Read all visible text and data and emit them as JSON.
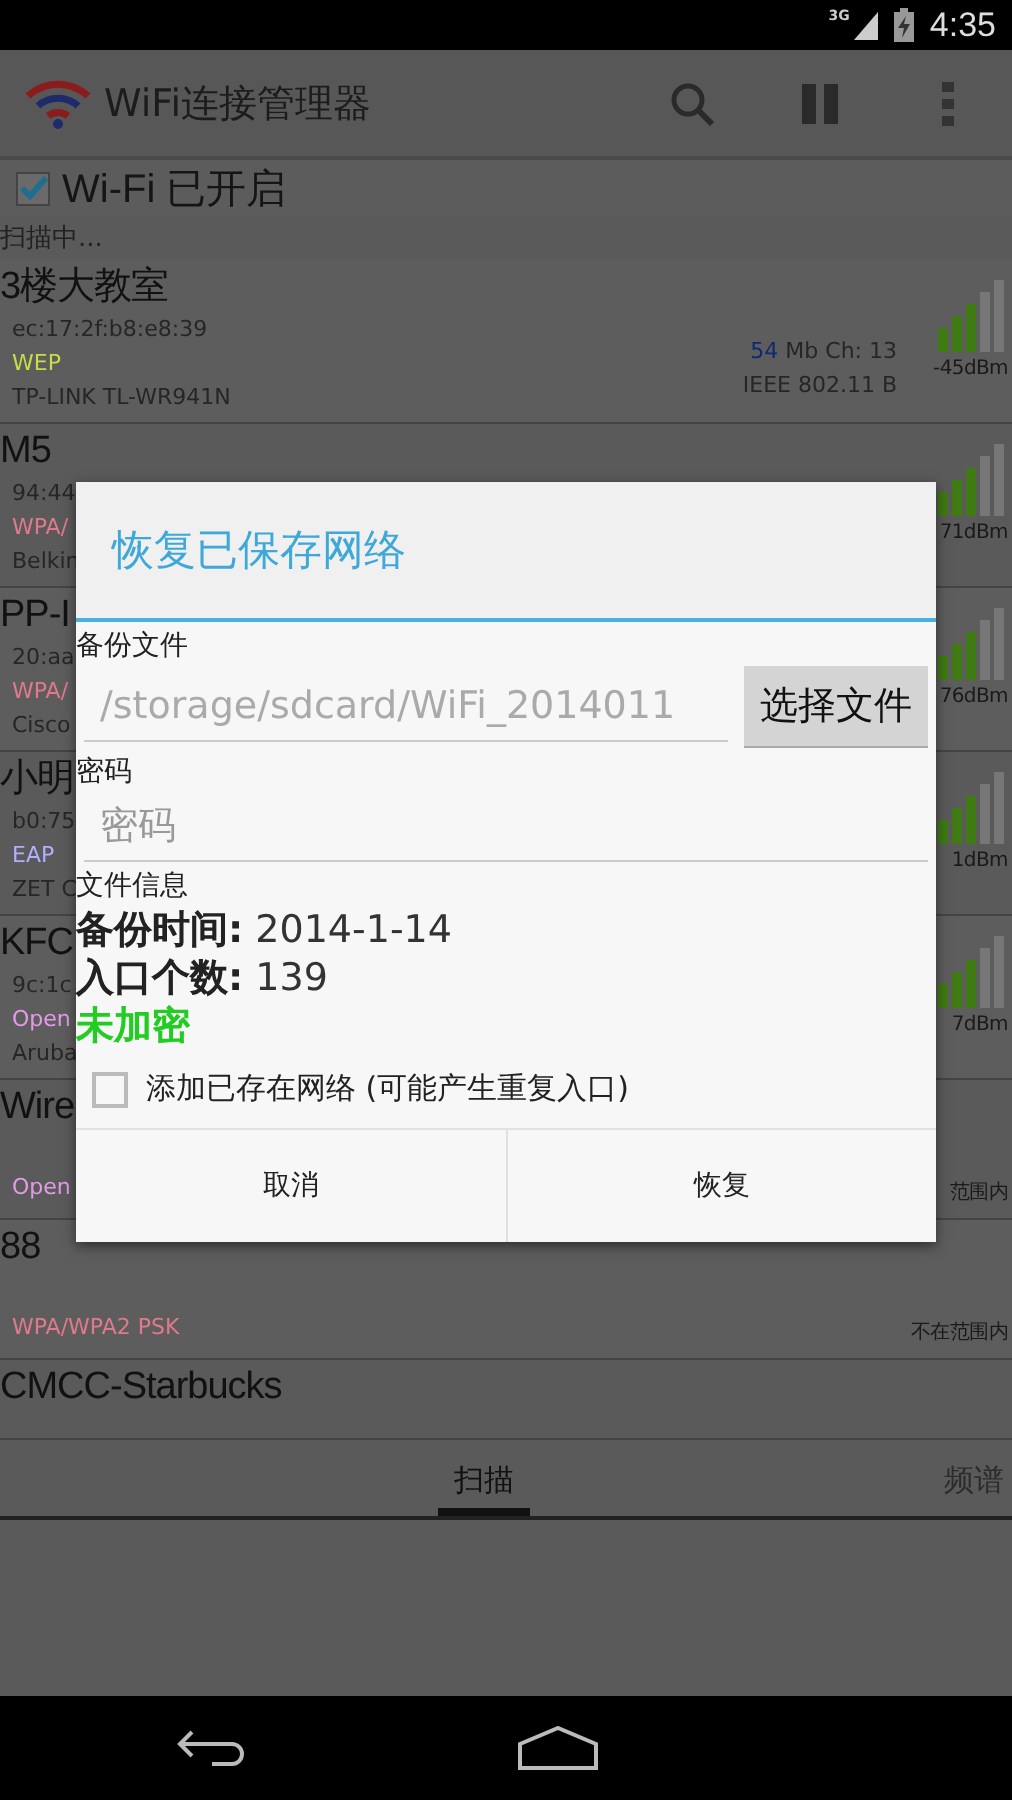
{
  "status_bar": {
    "network": "3G",
    "time": "4:35"
  },
  "toolbar": {
    "title": "WiFi连接管理器"
  },
  "wifi_toggle": {
    "label": "Wi-Fi 已开启",
    "checked": true
  },
  "scan_status": "扫描中...",
  "networks": [
    {
      "name": "3楼大教室",
      "mac": "ec:17:2f:b8:e8:39",
      "rate": "54",
      "rate_unit": "Mb",
      "channel": "Ch: 13",
      "security": {
        "text": "WEP",
        "color": "#c8dc48"
      },
      "standard": "IEEE 802.11 B",
      "vendor": "TP-LINK TL-WR941N",
      "reading": "-45dBm"
    },
    {
      "name": "M5",
      "mac": "94:44",
      "security": {
        "text": "WPA/",
        "color": "#e07a8a"
      },
      "vendor": "Belkin",
      "reading": "71dBm"
    },
    {
      "name": "PP-I",
      "mac": "20:aa",
      "security": {
        "text": "WPA/",
        "color": "#e07a8a"
      },
      "vendor": "Cisco",
      "reading": "76dBm"
    },
    {
      "name": "小明",
      "mac": "b0:75",
      "security": {
        "text": "EAP",
        "color": "#b0b0ff"
      },
      "vendor": "ZET C",
      "reading": "1dBm"
    },
    {
      "name": "KFC",
      "mac": "9c:1c",
      "security": {
        "text": "Open",
        "color": "#e29ae8"
      },
      "vendor": "Aruba",
      "reading": "7dBm"
    },
    {
      "name": "Wire",
      "security": {
        "text": "Open",
        "color": "#e29ae8"
      },
      "reading": "范围内"
    },
    {
      "name": "88",
      "security": {
        "text": "WPA/WPA2 PSK",
        "color": "#e07a8a"
      },
      "reading": "不在范围内"
    },
    {
      "name": "CMCC-Starbucks"
    }
  ],
  "tabs": [
    {
      "label": "扫描",
      "selected": true
    },
    {
      "label": "频谱",
      "selected": false
    }
  ],
  "dialog": {
    "title": "恢复已保存网络",
    "backup_label": "备份文件",
    "backup_value": "/storage/sdcard/WiFi_2014011",
    "choose_button": "选择文件",
    "password_label": "密码",
    "password_placeholder": "密码",
    "info_label": "文件信息",
    "info_lines": [
      "**备份时间:** 2014-1-14",
      "**入口个数:** 139"
    ],
    "encryption_status": "未加密",
    "add_existing": {
      "label": "添加已存在网络 (可能产生重复入口)",
      "checked": false
    },
    "buttons": [
      "取消",
      "恢复"
    ]
  }
}
